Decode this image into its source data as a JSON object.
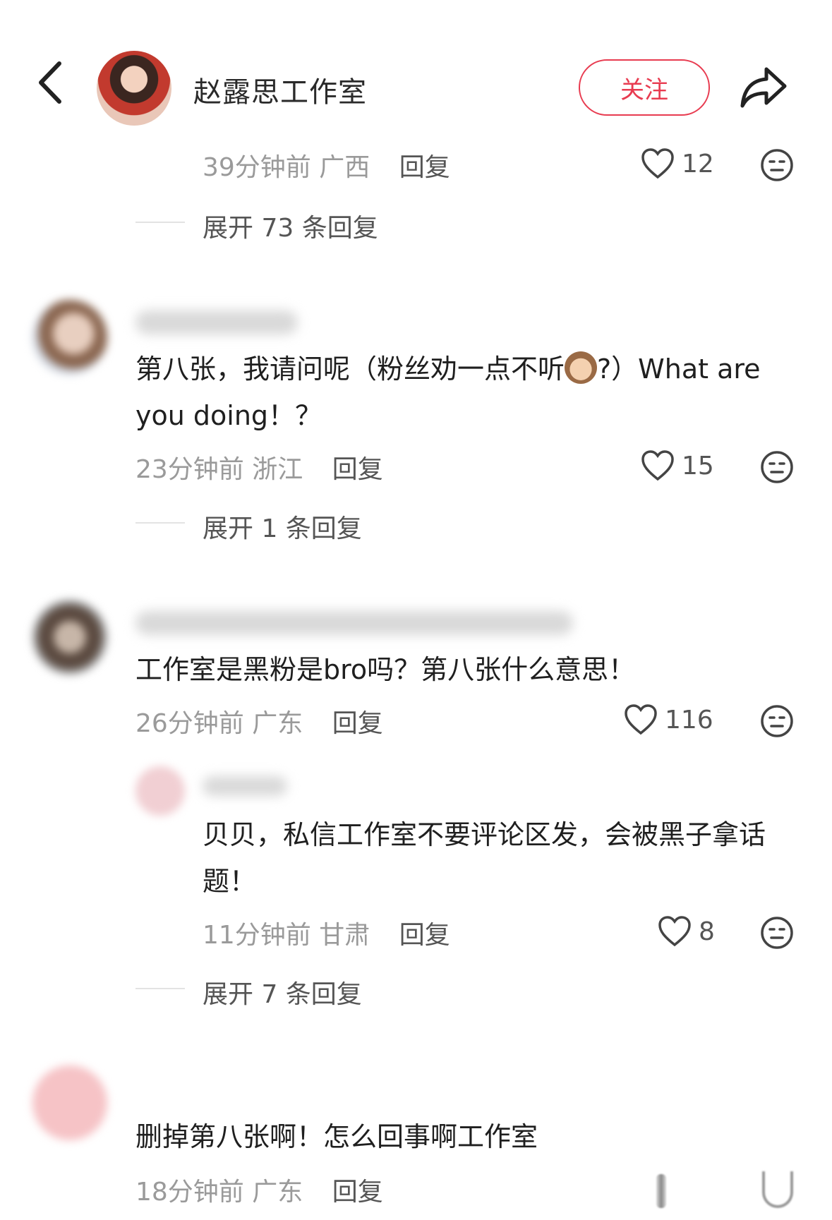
{
  "header": {
    "account_name": "赵露思工作室",
    "follow_label": "关注"
  },
  "top_item": {
    "time": "39分钟前",
    "location": "广西",
    "reply_label": "回复",
    "likes": "12",
    "expand": "展开 73 条回复"
  },
  "comments": [
    {
      "text_part1": "第八张，我请问呢（粉丝劝一点不听",
      "text_part2": "?）What are you doing！？",
      "time": "23分钟前",
      "location": "浙江",
      "reply_label": "回复",
      "likes": "15",
      "expand": "展开 1 条回复"
    },
    {
      "text": "工作室是黑粉是bro吗？第八张什么意思！",
      "time": "26分钟前",
      "location": "广东",
      "reply_label": "回复",
      "likes": "116"
    },
    {
      "text": "贝贝，私信工作室不要评论区发，会被黑子拿话题！",
      "time": "11分钟前",
      "location": "甘肃",
      "reply_label": "回复",
      "likes": "8",
      "expand": "展开 7 条回复"
    },
    {
      "text": "删掉第八张啊！怎么回事啊工作室",
      "time": "18分钟前",
      "location": "广东",
      "reply_label": "回复"
    }
  ],
  "colors": {
    "accent": "#e83b50",
    "meta_text": "#9a9a9a"
  }
}
